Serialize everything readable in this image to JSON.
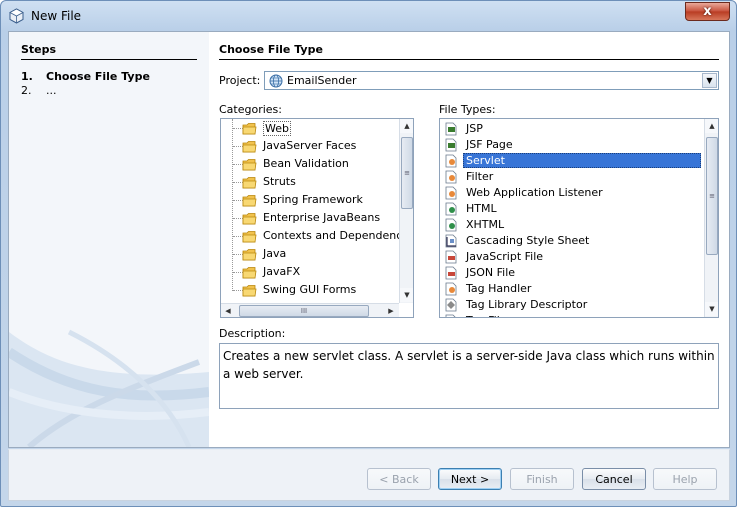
{
  "window": {
    "title": "New File",
    "close_glyph": "x"
  },
  "steps": {
    "title": "Steps",
    "items": [
      {
        "num": "1.",
        "label": "Choose File Type"
      },
      {
        "num": "2.",
        "label": "..."
      }
    ]
  },
  "main": {
    "title": "Choose File Type",
    "project_label": "Project:",
    "project_value": "EmailSender",
    "categories_label": "Categories:",
    "file_types_label": "File Types:",
    "description_label": "Description:",
    "description_text": "Creates a new servlet class. A servlet is a server-side Java class which runs within a web server."
  },
  "categories": [
    "Web",
    "JavaServer Faces",
    "Bean Validation",
    "Struts",
    "Spring Framework",
    "Enterprise JavaBeans",
    "Contexts and Dependency Injection",
    "Java",
    "JavaFX",
    "Swing GUI Forms"
  ],
  "file_types": [
    {
      "label": "JSP",
      "icon": "jsp-file-icon"
    },
    {
      "label": "JSF Page",
      "icon": "jsf-file-icon"
    },
    {
      "label": "Servlet",
      "icon": "servlet-file-icon"
    },
    {
      "label": "Filter",
      "icon": "filter-file-icon"
    },
    {
      "label": "Web Application Listener",
      "icon": "listener-file-icon"
    },
    {
      "label": "HTML",
      "icon": "html-file-icon"
    },
    {
      "label": "XHTML",
      "icon": "xhtml-file-icon"
    },
    {
      "label": "Cascading Style Sheet",
      "icon": "css-file-icon"
    },
    {
      "label": "JavaScript File",
      "icon": "javascript-file-icon"
    },
    {
      "label": "JSON File",
      "icon": "json-file-icon"
    },
    {
      "label": "Tag Handler",
      "icon": "tag-handler-icon"
    },
    {
      "label": "Tag Library Descriptor",
      "icon": "tld-file-icon"
    },
    {
      "label": "Tag File",
      "icon": "tag-file-icon"
    }
  ],
  "selected": {
    "category": "Web",
    "file_type": "Servlet"
  },
  "scroll_glyphs": {
    "up": "▲",
    "down": "▼",
    "left": "◀",
    "right": "▶",
    "grip_v": "≡",
    "grip_h": "III"
  },
  "buttons": {
    "back": "< Back",
    "next": "Next >",
    "finish": "Finish",
    "cancel": "Cancel",
    "help": "Help"
  },
  "colors": {
    "selection": "#3875d7",
    "title_gradient_top": "#cfe0f2",
    "close_red": "#c7503a"
  }
}
